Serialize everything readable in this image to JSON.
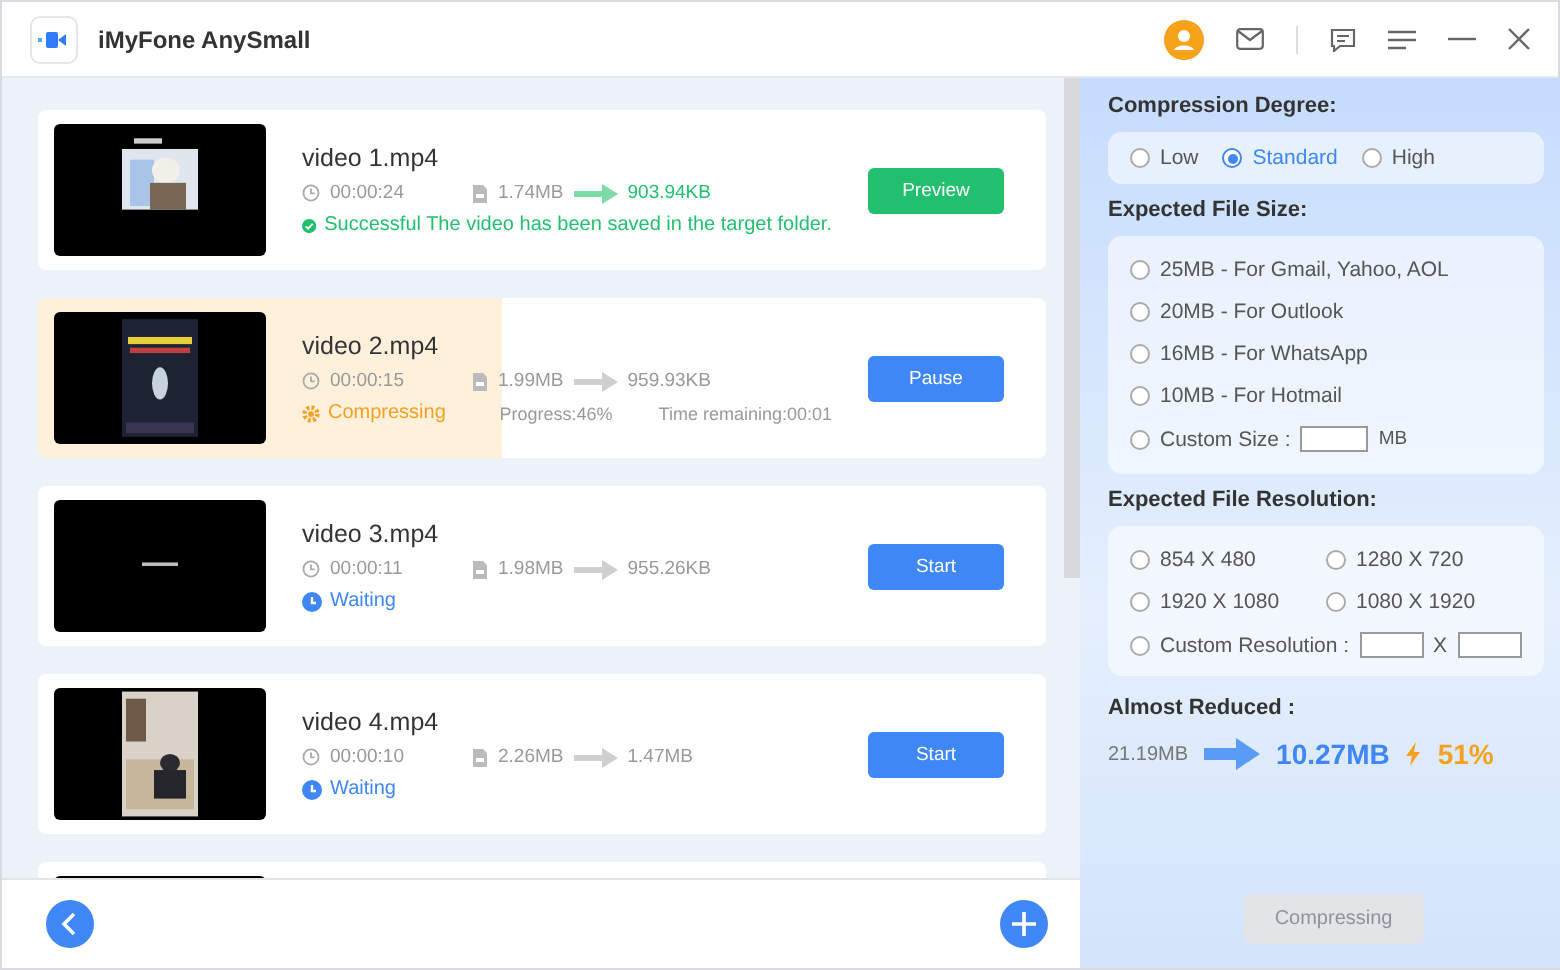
{
  "window": {
    "title": "iMyFone AnySmall"
  },
  "videos": [
    {
      "name": "video 1.mp4",
      "duration": "00:00:24",
      "original_size": "1.74MB",
      "compressed_size": "903.94KB",
      "status": {
        "kind": "success",
        "text": "Successful The video has been saved in the target folder."
      },
      "button": {
        "kind": "preview",
        "label": "Preview"
      }
    },
    {
      "name": "video 2.mp4",
      "duration": "00:00:15",
      "original_size": "1.99MB",
      "compressed_size": "959.93KB",
      "status": {
        "kind": "compressing",
        "text": "Compressing"
      },
      "progress": {
        "level": 0.46,
        "text": "Progress:46%",
        "remaining": "Time remaining:00:01"
      },
      "button": {
        "kind": "pause",
        "label": "Pause"
      }
    },
    {
      "name": "video 3.mp4",
      "duration": "00:00:11",
      "original_size": "1.98MB",
      "compressed_size": "955.26KB",
      "status": {
        "kind": "waiting",
        "text": "Waiting"
      },
      "button": {
        "kind": "start",
        "label": "Start"
      }
    },
    {
      "name": "video 4.mp4",
      "duration": "00:00:10",
      "original_size": "2.26MB",
      "compressed_size": "1.47MB",
      "status": {
        "kind": "waiting",
        "text": "Waiting"
      },
      "button": {
        "kind": "start",
        "label": "Start"
      }
    }
  ],
  "settings": {
    "compression_degree": {
      "title": "Compression Degree:",
      "options": [
        {
          "label": "Low",
          "selected": false
        },
        {
          "label": "Standard",
          "selected": true
        },
        {
          "label": "High",
          "selected": false
        }
      ]
    },
    "file_size": {
      "title": "Expected File Size:",
      "options": [
        {
          "label": "25MB - For Gmail, Yahoo, AOL",
          "selected": false
        },
        {
          "label": "20MB - For Outlook",
          "selected": false
        },
        {
          "label": "16MB - For WhatsApp",
          "selected": false
        },
        {
          "label": "10MB - For Hotmail",
          "selected": false
        }
      ],
      "custom": {
        "label": "Custom Size :",
        "unit": "MB",
        "selected": false
      }
    },
    "resolution": {
      "title": "Expected File Resolution:",
      "options": [
        {
          "label": "854 X 480",
          "selected": false
        },
        {
          "label": "1280 X 720",
          "selected": false
        },
        {
          "label": "1920 X 1080",
          "selected": false
        },
        {
          "label": "1080 X 1920",
          "selected": false
        }
      ],
      "custom": {
        "label": "Custom Resolution :",
        "separator": "X",
        "selected": false
      }
    },
    "reduced": {
      "title": "Almost Reduced :",
      "from": "21.19MB",
      "to": "10.27MB",
      "percent": "51%"
    },
    "compress_button": {
      "label": "Compressing",
      "disabled": true
    }
  }
}
